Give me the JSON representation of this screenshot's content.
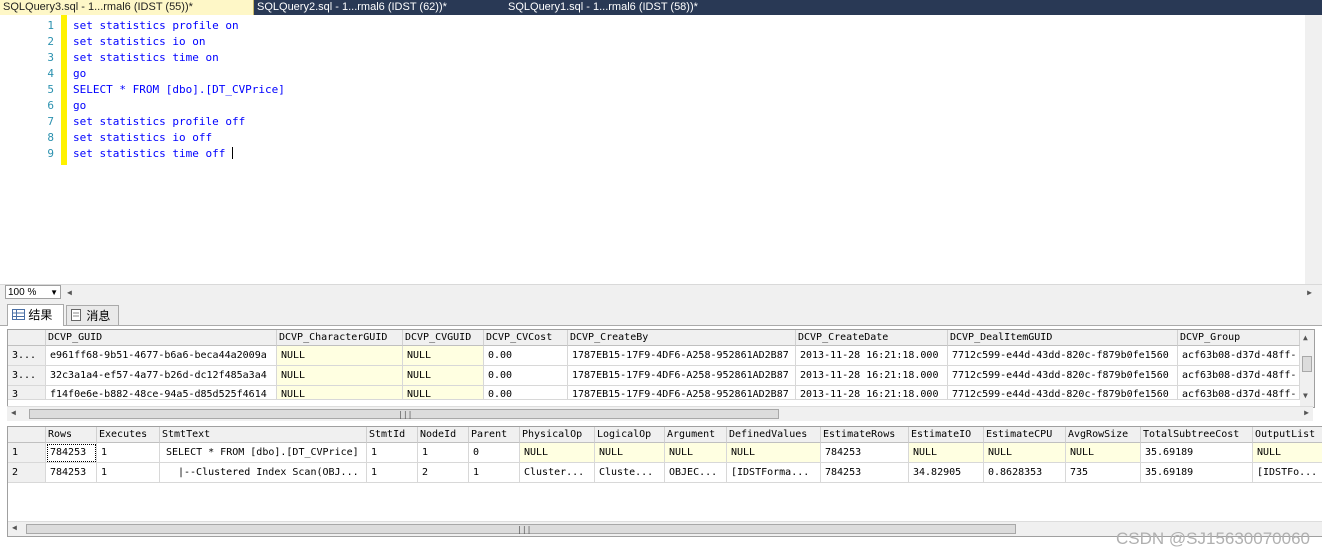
{
  "tabs": [
    {
      "label": "SQLQuery3.sql - 1...rmal6 (IDST (55))*",
      "active": true
    },
    {
      "label": "SQLQuery2.sql - 1...rmal6 (IDST (62))*",
      "active": false
    },
    {
      "label": "SQLQuery1.sql - 1...rmal6 (IDST (58))*",
      "active": false
    }
  ],
  "editor": {
    "line_numbers": [
      "1",
      "2",
      "3",
      "4",
      "5",
      "6",
      "7",
      "8",
      "9"
    ],
    "lines": [
      "set statistics profile on",
      "set statistics io on",
      "set statistics time on",
      "go",
      "SELECT * FROM [dbo].[DT_CVPrice]",
      "go",
      "set statistics profile off",
      "set statistics io off",
      "set statistics time off"
    ],
    "zoom": "100 %"
  },
  "results_tabs": {
    "results": "结果",
    "messages": "消息"
  },
  "grid1": {
    "columns": [
      "DCVP_GUID",
      "DCVP_CharacterGUID",
      "DCVP_CVGUID",
      "DCVP_CVCost",
      "DCVP_CreateBy",
      "DCVP_CreateDate",
      "DCVP_DealItemGUID",
      "DCVP_Group"
    ],
    "row_headers": [
      "3...",
      "3...",
      "3"
    ],
    "rows": [
      [
        "e961ff68-9b51-4677-b6a6-beca44a2009a",
        "NULL",
        "NULL",
        "0.00",
        "1787EB15-17F9-4DF6-A258-952861AD2B87",
        "2013-11-28 16:21:18.000",
        "7712c599-e44d-43dd-820c-f879b0fe1560",
        "acf63b08-d37d-48ff-"
      ],
      [
        "32c3a1a4-ef57-4a77-b26d-dc12f485a3a4",
        "NULL",
        "NULL",
        "0.00",
        "1787EB15-17F9-4DF6-A258-952861AD2B87",
        "2013-11-28 16:21:18.000",
        "7712c599-e44d-43dd-820c-f879b0fe1560",
        "acf63b08-d37d-48ff-"
      ],
      [
        "f14f0e6e-b882-48ce-94a5-d85d525f4614",
        "NULL",
        "NULL",
        "0.00",
        "1787EB15-17F9-4DF6-A258-952861AD2B87",
        "2013-11-28 16:21:18.000",
        "7712c599-e44d-43dd-820c-f879b0fe1560",
        "acf63b08-d37d-48ff-"
      ]
    ]
  },
  "grid2": {
    "columns": [
      "Rows",
      "Executes",
      "StmtText",
      "StmtId",
      "NodeId",
      "Parent",
      "PhysicalOp",
      "LogicalOp",
      "Argument",
      "DefinedValues",
      "EstimateRows",
      "EstimateIO",
      "EstimateCPU",
      "AvgRowSize",
      "TotalSubtreeCost",
      "OutputList"
    ],
    "row_headers": [
      "1",
      "2"
    ],
    "rows": [
      [
        "784253",
        "1",
        "SELECT * FROM [dbo].[DT_CVPrice]",
        "1",
        "1",
        "0",
        "NULL",
        "NULL",
        "NULL",
        "NULL",
        "784253",
        "NULL",
        "NULL",
        "NULL",
        "35.69189",
        "NULL"
      ],
      [
        "784253",
        "1",
        "|--Clustered Index Scan(OBJ...",
        "1",
        "2",
        "1",
        "Cluster...",
        "Cluste...",
        "OBJEC...",
        "[IDSTForma...",
        "784253",
        "34.82905",
        "0.8628353",
        "735",
        "35.69189",
        "[IDSTFo..."
      ]
    ]
  },
  "watermark": "CSDN @SJ15630070060"
}
